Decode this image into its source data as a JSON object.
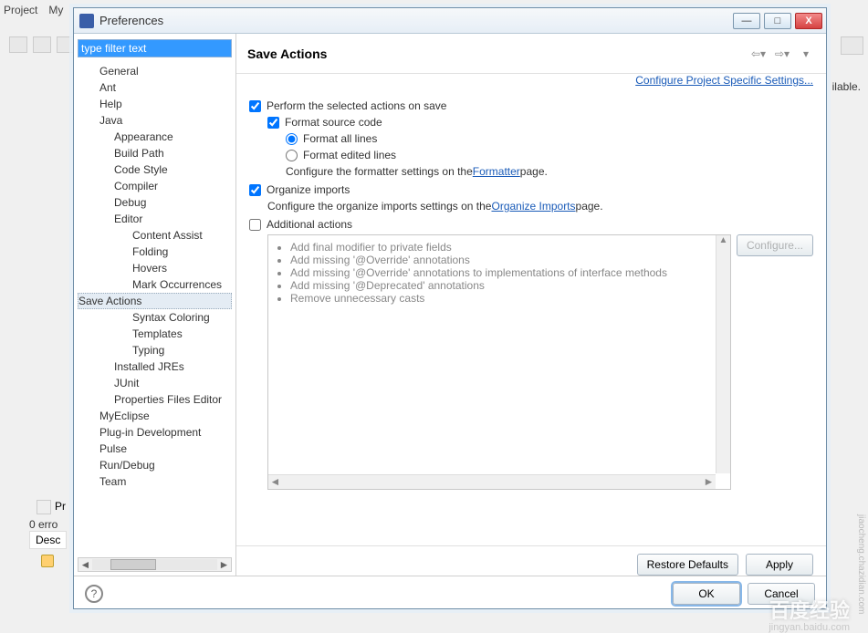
{
  "bg": {
    "menu": [
      "Project",
      "My"
    ],
    "right_text": "ilable.",
    "problems_tab": "Pr",
    "errors": "0 erro",
    "desc": "Desc"
  },
  "window": {
    "title": "Preferences",
    "min": "—",
    "max": "□",
    "close": "X"
  },
  "filter_placeholder": "type filter text",
  "tree": {
    "i0": "General",
    "i1": "Ant",
    "i2": "Help",
    "i3": "Java",
    "i4": "Appearance",
    "i5": "Build Path",
    "i6": "Code Style",
    "i7": "Compiler",
    "i8": "Debug",
    "i9": "Editor",
    "i10": "Content Assist",
    "i11": "Folding",
    "i12": "Hovers",
    "i13": "Mark Occurrences",
    "i14": "Save Actions",
    "i15": "Syntax Coloring",
    "i16": "Templates",
    "i17": "Typing",
    "i18": "Installed JREs",
    "i19": "JUnit",
    "i20": "Properties Files Editor",
    "i21": "MyEclipse",
    "i22": "Plug-in Development",
    "i23": "Pulse",
    "i24": "Run/Debug",
    "i25": "Team"
  },
  "page": {
    "title": "Save Actions",
    "config_link": "Configure Project Specific Settings...",
    "chk_perform": "Perform the selected actions on save",
    "chk_format": "Format source code",
    "radio_all": "Format all lines",
    "radio_edited": "Format edited lines",
    "formatter_pre": "Configure the formatter settings on the ",
    "formatter_link": "Formatter",
    "formatter_post": " page.",
    "chk_organize": "Organize imports",
    "organize_pre": "Configure the organize imports settings on the ",
    "organize_link": "Organize Imports",
    "organize_post": " page.",
    "chk_additional": "Additional actions",
    "configure_btn": "Configure...",
    "actions": {
      "a0": "Add final modifier to private fields",
      "a1": "Add missing '@Override' annotations",
      "a2": "Add missing '@Override' annotations to implementations of interface methods",
      "a3": "Add missing '@Deprecated' annotations",
      "a4": "Remove unnecessary casts"
    },
    "restore": "Restore Defaults",
    "apply": "Apply",
    "help": "?",
    "ok": "OK",
    "cancel": "Cancel"
  },
  "watermark": {
    "main": "百度经验",
    "sub": "jingyan.baidu.com",
    "side": "jiaocheng.chazidian.com"
  }
}
